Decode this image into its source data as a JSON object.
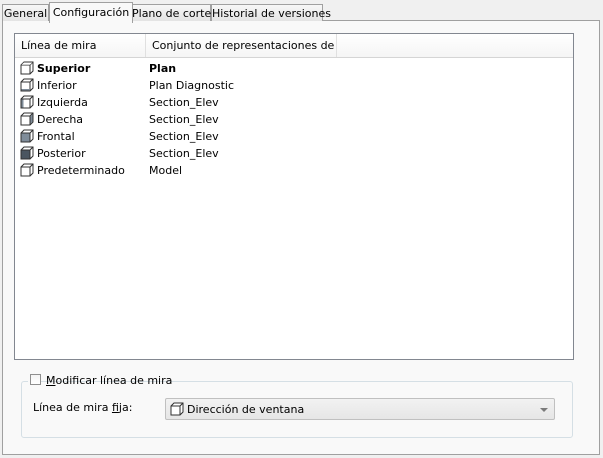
{
  "tabs": [
    {
      "label": "General",
      "active": false
    },
    {
      "label": "Configuración",
      "active": true
    },
    {
      "label": "Plano de corte",
      "active": false
    },
    {
      "label": "Historial de versiones",
      "active": false
    }
  ],
  "list": {
    "columns": [
      "Línea de mira",
      "Conjunto de representaciones de ..."
    ],
    "rows": [
      {
        "name": "Superior",
        "value": "Plan",
        "bold": true,
        "icon": "cube-top-icon"
      },
      {
        "name": "Inferior",
        "value": "Plan Diagnostic",
        "bold": false,
        "icon": "cube-bottom-icon"
      },
      {
        "name": "Izquierda",
        "value": "Section_Elev",
        "bold": false,
        "icon": "cube-left-icon"
      },
      {
        "name": "Derecha",
        "value": "Section_Elev",
        "bold": false,
        "icon": "cube-right-icon"
      },
      {
        "name": "Frontal",
        "value": "Section_Elev",
        "bold": false,
        "icon": "cube-front-icon"
      },
      {
        "name": "Posterior",
        "value": "Section_Elev",
        "bold": false,
        "icon": "cube-back-icon"
      },
      {
        "name": "Predeterminado",
        "value": "Model",
        "bold": false,
        "icon": "cube-default-icon"
      }
    ]
  },
  "override": {
    "checkbox_label_prefix": "M",
    "checkbox_label_rest": "odificar línea de mira",
    "checked": false,
    "fixed_label_prefix": "Línea de mira ",
    "fixed_label_underlined": "f",
    "fixed_label_rest": "ija:",
    "combo_value": "Dirección de ventana"
  },
  "colors": {
    "tab_border": "#a0a0a0",
    "list_border": "#828790",
    "cube_stroke": "#303030",
    "cube_face": "#7f8c99"
  }
}
